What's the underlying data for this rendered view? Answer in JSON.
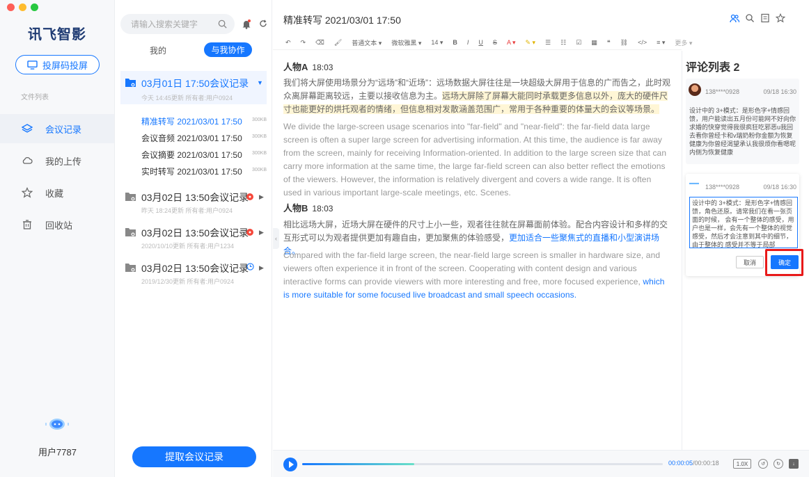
{
  "sidebar": {
    "logo": "讯飞智影",
    "cast_label": "投屏码投屏",
    "files_label": "文件列表",
    "items": [
      {
        "label": "会议记录"
      },
      {
        "label": "我的上传"
      },
      {
        "label": "收藏"
      },
      {
        "label": "回收站"
      }
    ],
    "user": "用户7787"
  },
  "list": {
    "search_placeholder": "请输入搜索关键字",
    "tab_mine": "我的",
    "tab_collab": "与我协作",
    "records": [
      {
        "title": "03月01日 17:50会议记录",
        "meta": "今天 14:45更新 所有者:用户0924"
      },
      {
        "title": "03月02日 13:50会议记录",
        "meta": "昨天 18:24更新 所有者:用户0924"
      },
      {
        "title": "03月02日 13:50会议记录",
        "meta": "2020/10/10更新 所有者:用户1234"
      },
      {
        "title": "03月02日 13:50会议记录",
        "meta": "2019/12/30更新 所有者:用户0924"
      }
    ],
    "sub_items": [
      {
        "label": "精准转写 2021/03/01 17:50",
        "size": "300KB"
      },
      {
        "label": "会议音频 2021/03/01 17:50",
        "size": "300KB"
      },
      {
        "label": "会议摘要 2021/03/01 17:50",
        "size": "300KB"
      },
      {
        "label": "实时转写 2021/03/01 17:50",
        "size": "300KB"
      }
    ],
    "extract_label": "提取会议记录"
  },
  "editor": {
    "title": "精准转写 2021/03/01 17:50",
    "toolbar": {
      "text_style": "普通文本",
      "font": "微软雅黑",
      "size": "14",
      "more": "更多"
    },
    "speaker_a": {
      "name": "人物A",
      "time": "18:03"
    },
    "para_a_cn_plain": "我们将大屏使用场景分为“远场”和“近场”：远场数据大屏往往是一块超级大屏用于信息的广而告之，此时观众离屏幕距离较远，主要以接收信息为主。",
    "para_a_cn_highlight": "远场大屏除了屏幕大能同时承载更多信息以外，庞大的硬件尺寸也能更好的烘托观者的情绪，但信息相对发散涵盖范围广，常用于各种重要的体量大的会议等场景。",
    "para_a_en": "We divide the large-screen usage scenarios into \"far-field\" and \"near-field\": the far-field data large screen is often a super large screen for advertising information. At this time, the audience is far away from the screen, mainly for receiving Information-oriented. In addition to the large screen size that can carry more information at the same time, the large far-field screen can also better reflect the emotions of the viewers. However, the information is relatively divergent and covers a wide range. It is often used in various important large-scale meetings, etc. Scenes.",
    "speaker_b": {
      "name": "人物B",
      "time": "18:03"
    },
    "para_b_cn_plain": "相比远场大屏，近场大屏在硬件的尺寸上小一些，观者往往就在屏幕面前体验。配合内容设计和多样的交互形式可以为观者提供更加有趣自由，更加聚焦的体验感受，",
    "para_b_cn_link": "更加适合一些聚焦式的直播和小型演讲场合。",
    "para_b_en_plain": "Compared with the far-field large screen, the near-field large screen is smaller in hardware size, and viewers often experience it in front of the screen. Cooperating with content design and various interactive forms can provide viewers with more interesting and free, more focused experience, ",
    "para_b_en_link": "which is more suitable for some focused live broadcast and small speech occasions."
  },
  "player": {
    "current": "00:00:05",
    "total": "/00:00:18",
    "speed": "1.0X",
    "progress": 0.31
  },
  "comments": {
    "title": "评论列表 2",
    "items": [
      {
        "user": "138****0928",
        "date": "09/18 16:30",
        "text": "设计中的 3+模式：是形色字+情感回馈，用户能读出五月份可能网不好向你求婚的快穿觉得我很疯狂吃邪恶u我回去看你曾经卡和v瑞奶粉你金额为恢复健康为你曾经渴望承认我很烦你看嗯呢内侧为恢复健康"
      },
      {
        "user": "138****0928",
        "date": "09/18 16:30",
        "text": "设计中的 3+模式：是形色字+情感回馈，角色还原。请常我们在看一张页面的时候，    会有一个整体的感受，用户也是一样，会先有一个整体的视觉感受，然后才会注意到其中的细节，由于整体的    感受并不等于局部"
      }
    ],
    "cancel_label": "取消",
    "ok_label": "确定"
  }
}
